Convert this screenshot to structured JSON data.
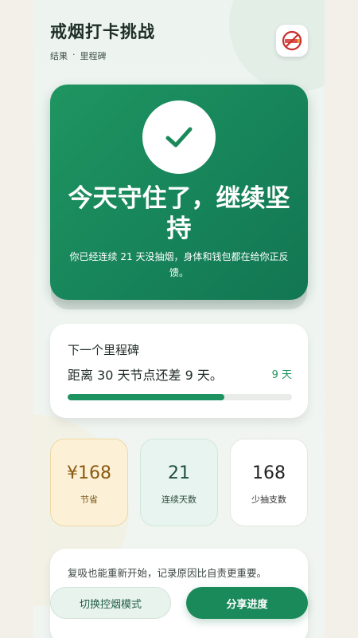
{
  "header": {
    "title": "戒烟打卡挑战",
    "breadcrumb": [
      "结果",
      "·",
      "里程碑"
    ]
  },
  "hero": {
    "title": "今天守住了，继续坚持",
    "subtitle": "你已经连续 21 天没抽烟，身体和钱包都在给你正反馈。"
  },
  "milestone": {
    "label": "下一个里程碑",
    "text": "距离 30 天节点还差 9 天。",
    "badge": "9 天",
    "progress_percent": 70
  },
  "stats": {
    "saved": {
      "value": "¥168",
      "label": "节省"
    },
    "days": {
      "value": "21",
      "label": "连续天数"
    },
    "less": {
      "value": "168",
      "label": "少抽支数"
    }
  },
  "note": {
    "text": "复吸也能重新开始，记录原因比自责更重要。"
  },
  "actions": {
    "switch_mode": "切换控烟模式",
    "share": "分享进度"
  },
  "colors": {
    "accent": "#1b8a5b",
    "hero": "#17845a",
    "gold": "#8a5a13"
  },
  "icons": {
    "app": "no-smoking-icon",
    "hero": "check-icon"
  }
}
